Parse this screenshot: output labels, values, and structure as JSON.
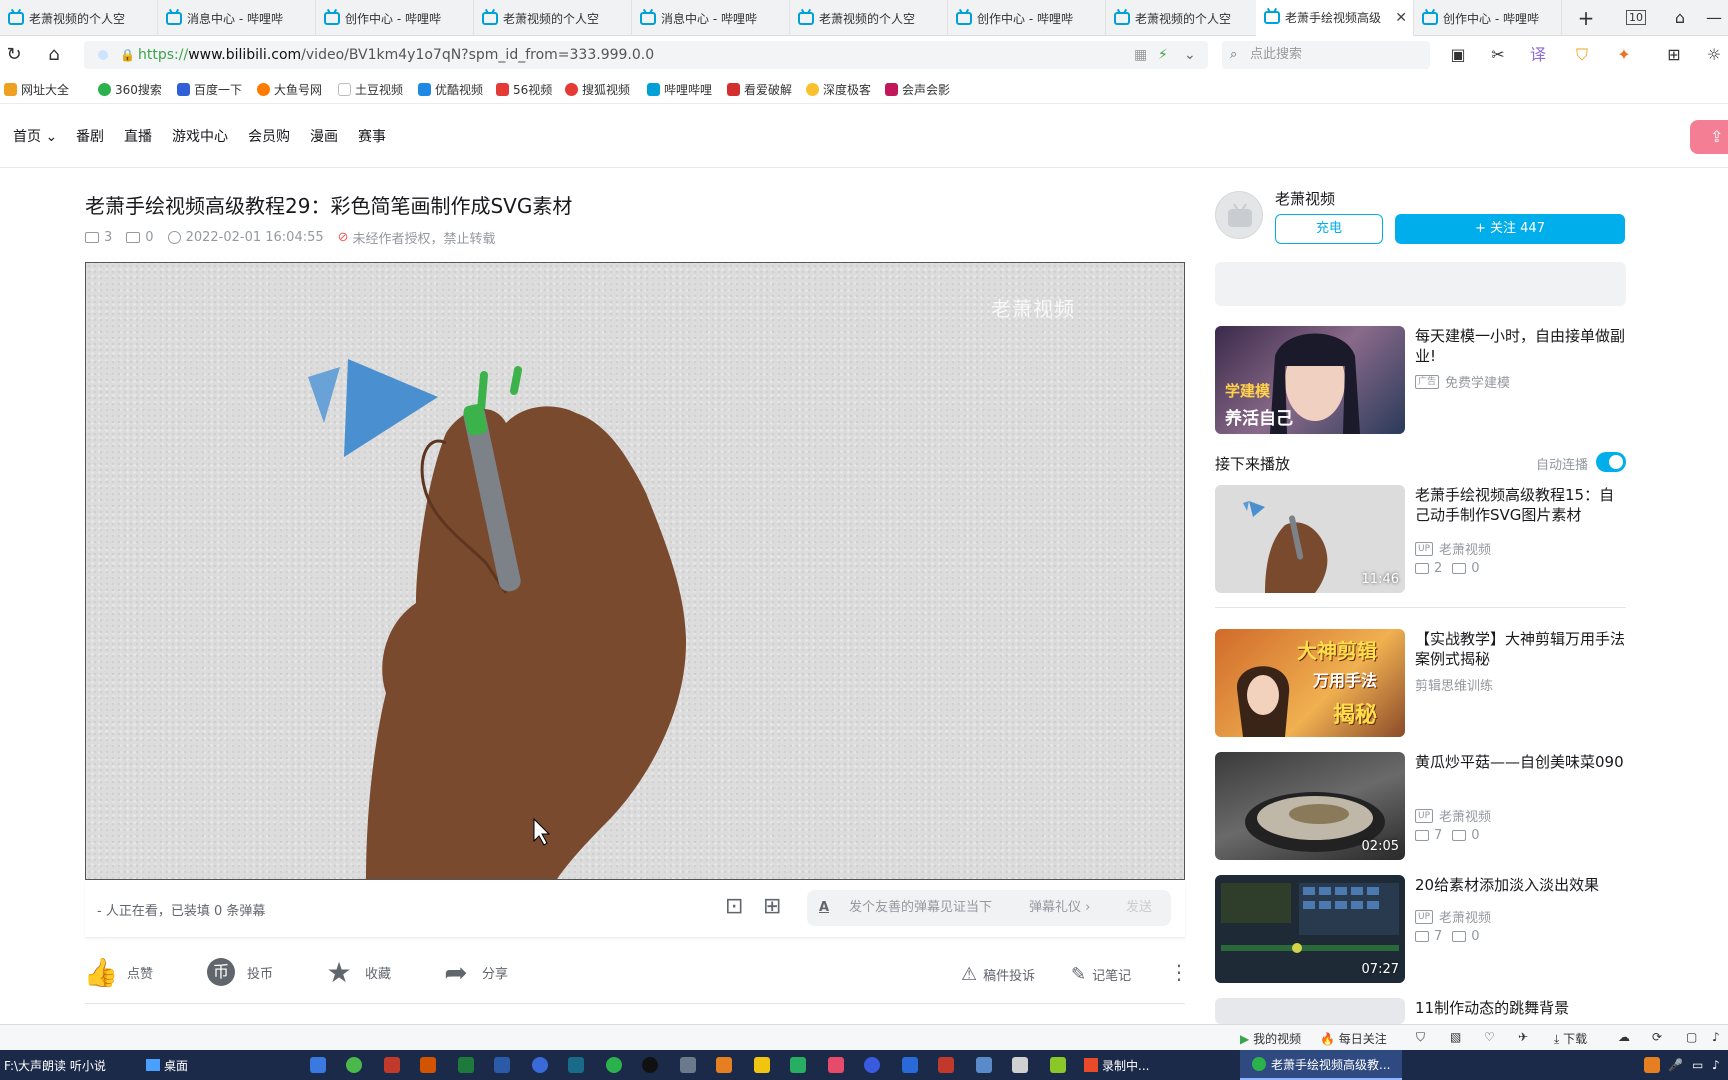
{
  "browser": {
    "tabs": [
      {
        "title": "老萧视频的个人空"
      },
      {
        "title": "消息中心 - 哔哩哔"
      },
      {
        "title": "创作中心 - 哔哩哔"
      },
      {
        "title": "老萧视频的个人空"
      },
      {
        "title": "消息中心 - 哔哩哔"
      },
      {
        "title": "老萧视频的个人空"
      },
      {
        "title": "创作中心 - 哔哩哔"
      },
      {
        "title": "老萧视频的个人空"
      },
      {
        "title": "老萧手绘视频高级"
      },
      {
        "title": "创作中心 - 哔哩哔"
      }
    ],
    "tab_count": "10",
    "url_prefix": "https://",
    "url_host": "www.bilibili.com",
    "url_path": "/video/BV1km4y1o7qN?spm_id_from=333.999.0.0",
    "search_placeholder": "点此搜索",
    "bookmarks": [
      {
        "label": "网址大全",
        "color": "#f0a020"
      },
      {
        "label": "360搜索",
        "color": "#2bb24c"
      },
      {
        "label": "百度一下",
        "color": "#3060d8"
      },
      {
        "label": "大鱼号网",
        "color": "#ff7a00"
      },
      {
        "label": "土豆视频",
        "color": "#bbbbbb"
      },
      {
        "label": "优酷视频",
        "color": "#1e88e5"
      },
      {
        "label": "56视频",
        "color": "#e53935"
      },
      {
        "label": "搜狐视频",
        "color": "#e53935"
      },
      {
        "label": "哔哩哔哩",
        "color": "#00a1d6"
      },
      {
        "label": "看爱破解",
        "color": "#d32f2f"
      },
      {
        "label": "深度极客",
        "color": "#fbc02d"
      },
      {
        "label": "会声会影",
        "color": "#c2185b"
      }
    ]
  },
  "site_nav": {
    "items": [
      "首页",
      "番剧",
      "直播",
      "游戏中心",
      "会员购",
      "漫画",
      "赛事"
    ]
  },
  "video": {
    "title": "老萧手绘视频高级教程29：彩色简笔画制作成SVG素材",
    "plays": "3",
    "danmaku": "0",
    "date": "2022-02-01 16:04:55",
    "copyright": "未经作者授权，禁止转载",
    "watermark": "老萧视频"
  },
  "danmu_bar": {
    "status": "- 人正在看，已装填 0 条弹幕",
    "placeholder": "发个友善的弹幕见证当下",
    "etiquette": "弹幕礼仪 ›",
    "send": "发送"
  },
  "actions": {
    "like": "点赞",
    "coin": "投币",
    "favorite": "收藏",
    "share": "分享",
    "report": "稿件投诉",
    "note": "记笔记"
  },
  "uploader": {
    "name": "老萧视频",
    "charge": "充电",
    "follow": "+ 关注 447"
  },
  "ad_card": {
    "title": "每天建模一小时，自由接单做副业!",
    "tag": "广告",
    "source": "免费学建模",
    "thumb_text_top": "学建模",
    "thumb_text_bottom": "养活自己"
  },
  "next": {
    "label": "接下来播放",
    "autoplay": "自动连播",
    "autoplay_on": true
  },
  "recommendations": [
    {
      "title": "老萧手绘视频高级教程15：自己动手制作SVG图片素材",
      "up": "老萧视频",
      "plays": "2",
      "danmaku": "0",
      "duration": "11:46"
    },
    {
      "title": "【实战教学】大神剪辑万用手法案例式揭秘",
      "up": "剪辑思维训练",
      "plays": "",
      "danmaku": "",
      "duration": "",
      "thumb_line1": "大神剪辑",
      "thumb_line2": "万用手法",
      "thumb_line3": "揭秘"
    },
    {
      "title": "黄瓜炒平菇——自创美味菜090",
      "up": "老萧视频",
      "plays": "7",
      "danmaku": "0",
      "duration": "02:05"
    },
    {
      "title": "20给素材添加淡入淡出效果",
      "up": "老萧视频",
      "plays": "7",
      "danmaku": "0",
      "duration": "07:27"
    },
    {
      "title": "11制作动态的跳舞背景"
    }
  ],
  "statusbar": {
    "my_video": "我的视频",
    "daily": "每日关注",
    "download": "下载"
  },
  "taskbar": {
    "tts": "F:\\大声朗读 听小说",
    "desktop": "桌面",
    "recorder": "录制中...",
    "browser": "老萧手绘视频高级教..."
  },
  "colors": {
    "accent": "#00aeec",
    "upload_pink": "#f47e93",
    "taskbar": "#1c2a4a",
    "copyright_red": "#f25d59"
  }
}
